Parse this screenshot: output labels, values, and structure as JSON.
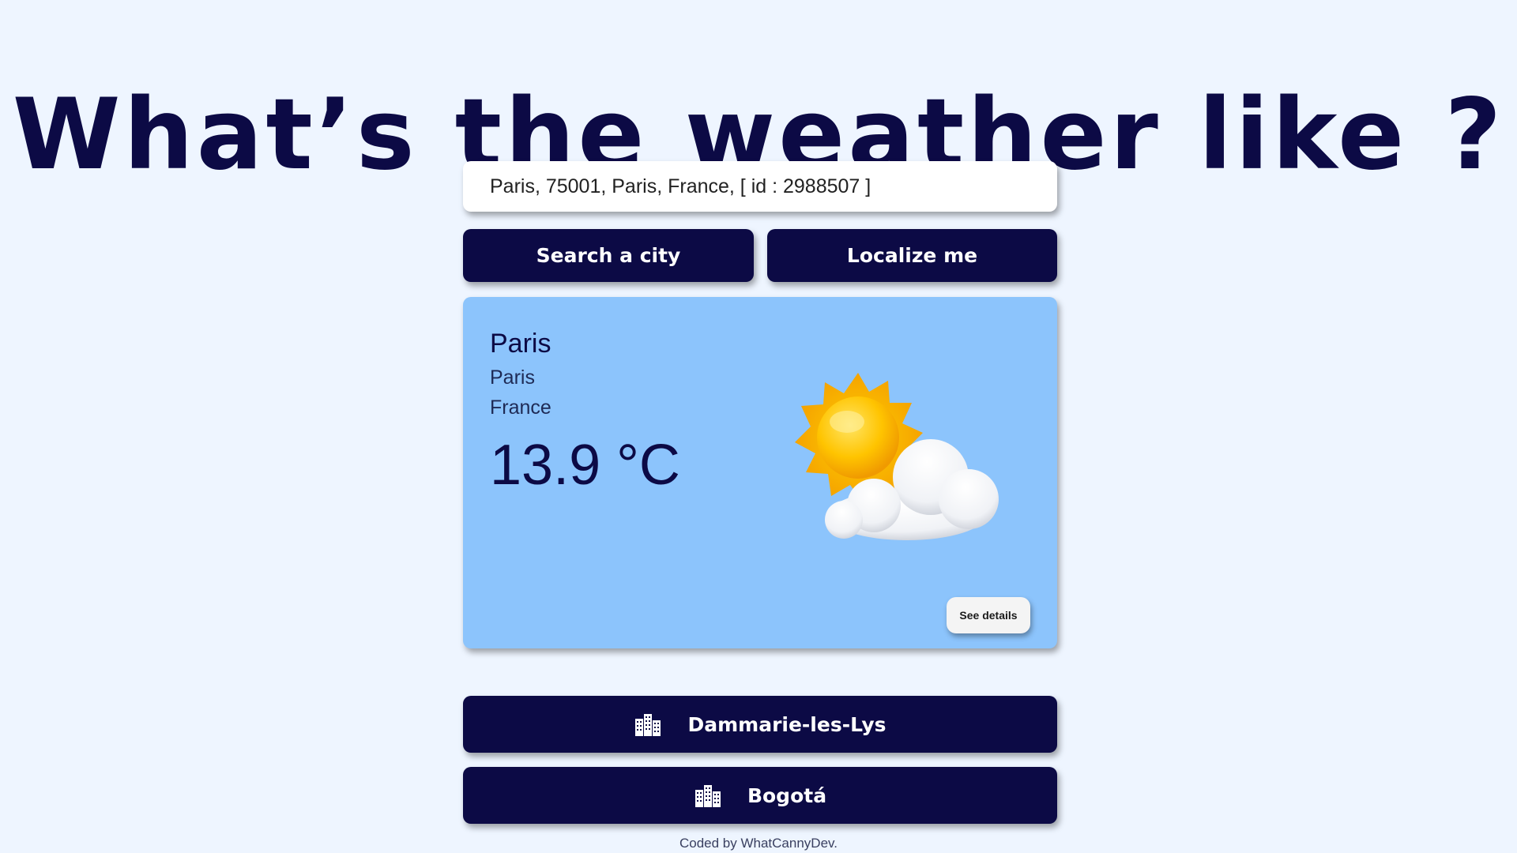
{
  "header": {
    "title": "What’s the weather like ?"
  },
  "search": {
    "value": "Paris, 75001, Paris, France, [ id : 2988507 ]"
  },
  "actions": {
    "search_label": "Search a city",
    "localize_label": "Localize me"
  },
  "weather_card": {
    "city": "Paris",
    "region": "Paris",
    "country": "France",
    "temperature": "13.9 °C",
    "icon": "partly-cloudy-icon",
    "details_label": "See details",
    "background_color": "#8cc4fc"
  },
  "recent_cities": [
    {
      "label": "Dammarie-les-Lys",
      "icon": "city-buildings-icon"
    },
    {
      "label": "Bogotá",
      "icon": "city-buildings-icon"
    }
  ],
  "footer": {
    "text": "Coded by WhatCannyDev."
  },
  "colors": {
    "page_background": "#eef5ff",
    "primary": "#0c0a45",
    "card": "#8cc4fc"
  }
}
